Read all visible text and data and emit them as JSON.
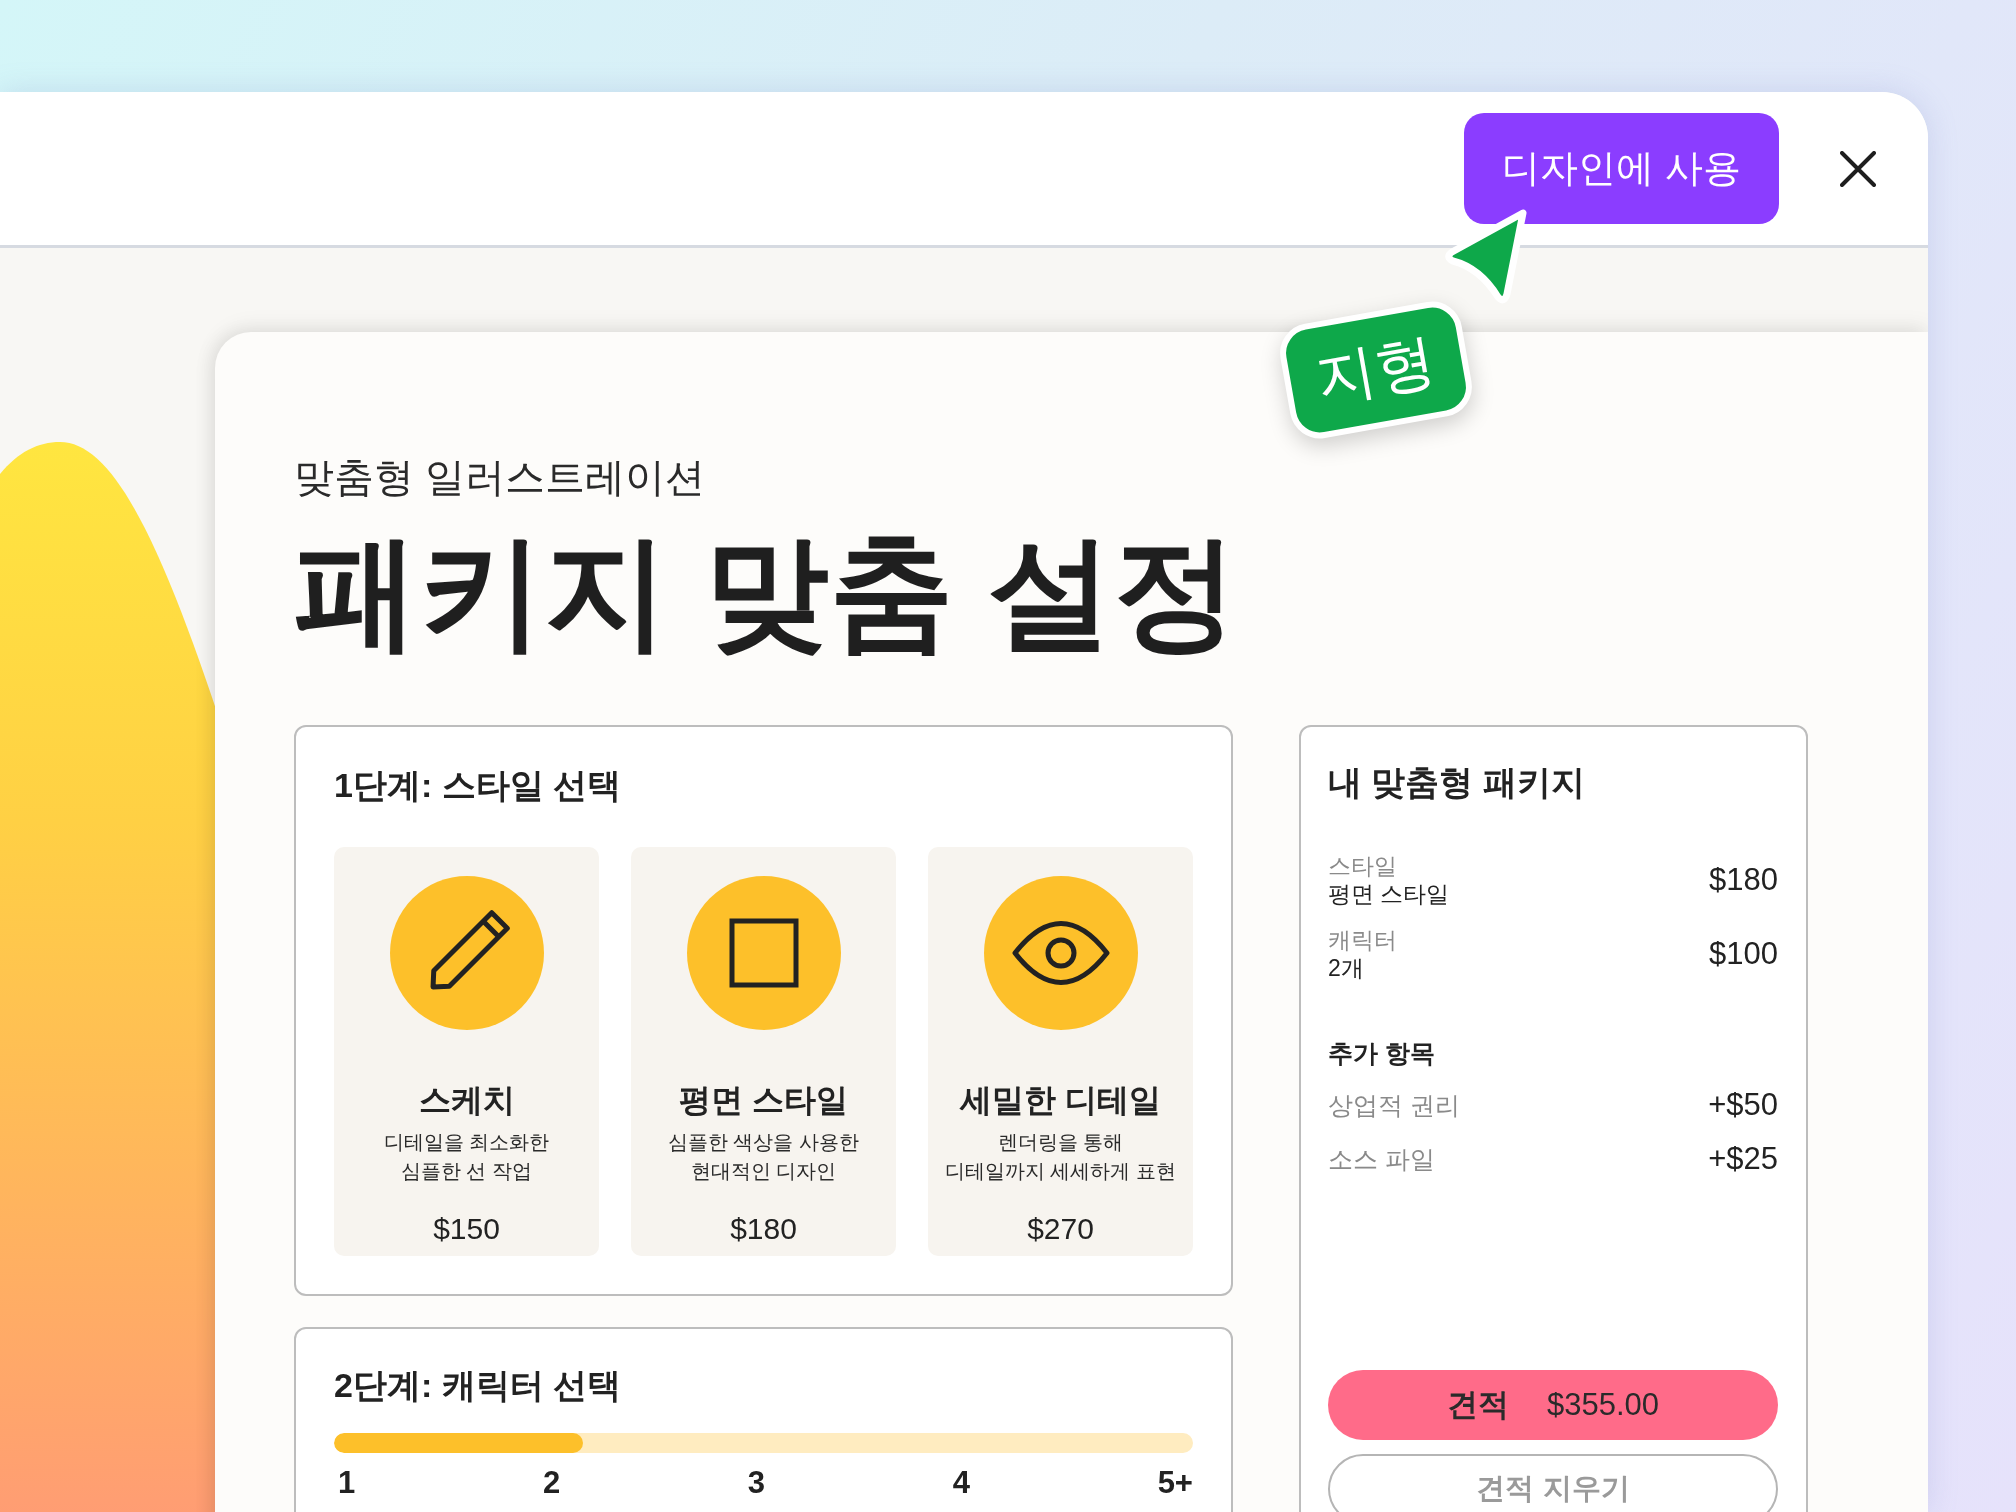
{
  "header": {
    "button": "디자인에 사용"
  },
  "collaborator_tag": {
    "name": "지형"
  },
  "intro": {
    "subtitle": "맞춤형 일러스트레이션",
    "title": "패키지 맞춤 설정"
  },
  "step1": {
    "heading": "1단계: 스타일 선택",
    "options": [
      {
        "name": "스케치",
        "description": [
          "디테일을 최소화한",
          "심플한 선 작업"
        ],
        "price": "$150"
      },
      {
        "name": "평면 스타일",
        "description": [
          "심플한 색상을 사용한",
          "현대적인 디자인"
        ],
        "price": "$180"
      },
      {
        "name": "세밀한 디테일",
        "description": [
          "렌더링을 통해",
          "디테일까지 세세하게 표현"
        ],
        "price": "$270"
      }
    ]
  },
  "step2": {
    "heading": "2단계: 캐릭터 선택",
    "slider": {
      "level": 0.29,
      "ticks": [
        "1",
        "2",
        "3",
        "4",
        "5+"
      ]
    }
  },
  "summary": {
    "heading": "내 맞춤형 패키지",
    "items": [
      {
        "label": "스타일",
        "value": "평면 스타일",
        "price": "$180"
      },
      {
        "label": "캐릭터",
        "value": "2개",
        "price": "$100"
      }
    ],
    "extras_heading": "추가 항목",
    "extras": [
      {
        "label": "상업적 권리",
        "price": "+$50"
      },
      {
        "label": "소스 파일",
        "price": "+$25"
      }
    ],
    "quote_button": {
      "label": "견적",
      "total": "$355.00"
    },
    "clear_button": "견적 지우기"
  }
}
